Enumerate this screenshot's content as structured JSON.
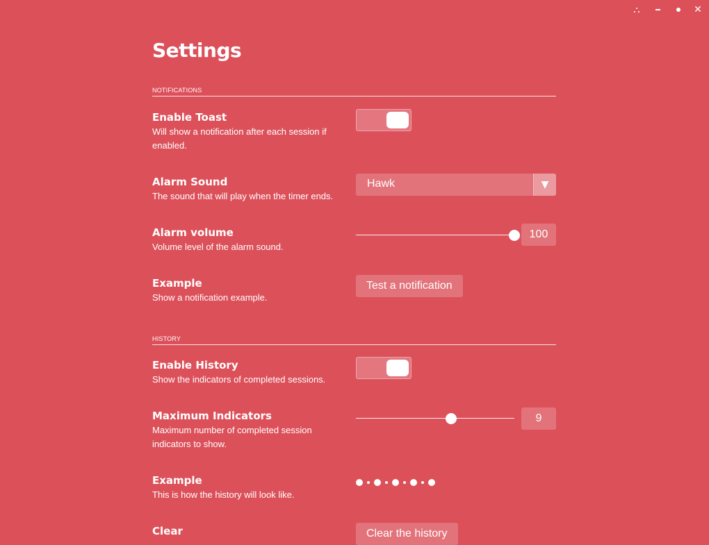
{
  "window_controls": {
    "menu_icon": "three-dots-icon",
    "minimize_icon": "minimize-icon",
    "maximize_icon": "maximize-icon",
    "close_icon": "close-icon",
    "close_glyph": "✕"
  },
  "page": {
    "title": "Settings"
  },
  "notifications": {
    "section_title": "NOTIFICATIONS",
    "enable_toast": {
      "label": "Enable Toast",
      "description": "Will show a notification after each session if enabled.",
      "enabled": true
    },
    "alarm_sound": {
      "label": "Alarm Sound",
      "description": "The sound that will play when the timer ends.",
      "selected": "Hawk",
      "arrow_glyph": "▼"
    },
    "alarm_volume": {
      "label": "Alarm volume",
      "description": "Volume level of the alarm sound.",
      "value": 100,
      "value_text": "100",
      "min": 0,
      "max": 100
    },
    "example": {
      "label": "Example",
      "description": "Show a notification example.",
      "button_label": "Test a notification"
    }
  },
  "history": {
    "section_title": "HISTORY",
    "enable_history": {
      "label": "Enable History",
      "description": "Show the indicators of completed sessions.",
      "enabled": true
    },
    "maximum_indicators": {
      "label": "Maximum Indicators",
      "description": "Maximum number of completed session indicators to show.",
      "value": 9,
      "value_text": "9",
      "min": 0,
      "max": 15
    },
    "example": {
      "label": "Example",
      "description": "This is how the history will look like.",
      "indicators": [
        "big",
        "small",
        "big",
        "small",
        "big",
        "small",
        "big",
        "small",
        "big"
      ]
    },
    "clear": {
      "label": "Clear",
      "button_label": "Clear the history"
    }
  },
  "colors": {
    "background": "#dc505a",
    "foreground": "#ffffff"
  }
}
